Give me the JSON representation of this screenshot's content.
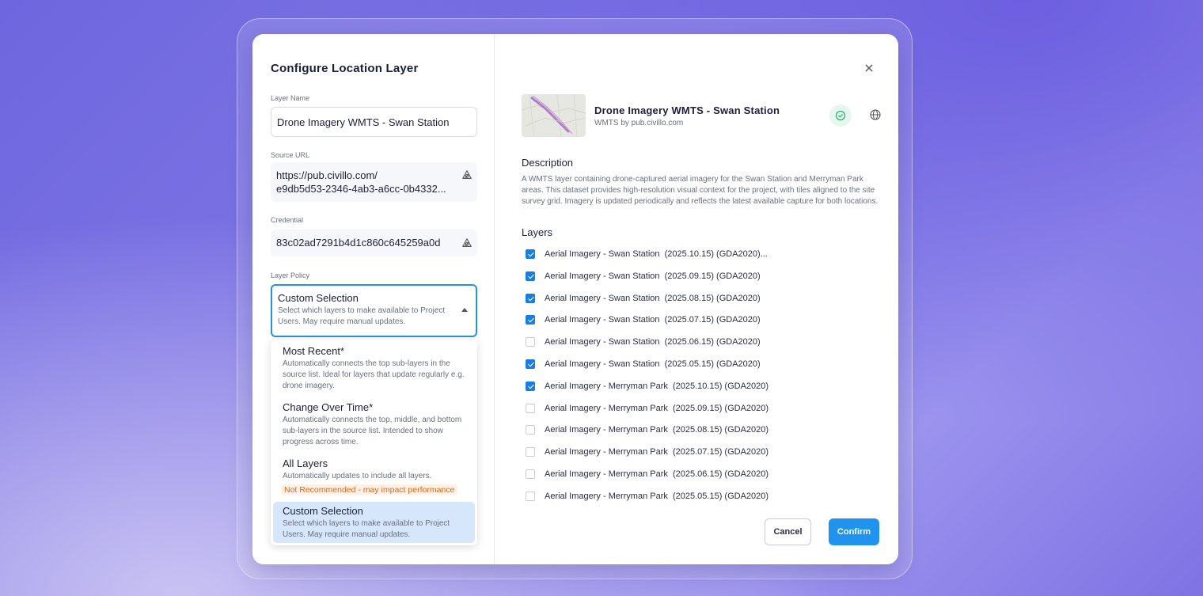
{
  "dialog": {
    "title": "Configure Location Layer",
    "layer_name_label": "Layer Name",
    "layer_name_value": "Drone Imagery WMTS - Swan Station",
    "source_url_label": "Source URL",
    "source_url_line1": "https://pub.civillo.com/",
    "source_url_line2": "e9db5d53-2346-4ab3-a6cc-0b4332...",
    "credential_label": "Credential",
    "credential_value": "83c02ad7291b4d1c860c645259a0d",
    "policy_label": "Layer Policy",
    "policy_selected": {
      "name": "Custom Selection",
      "desc": "Select which layers to make available to Project Users. May require manual updates."
    },
    "policy_options": [
      {
        "name": "Most Recent*",
        "desc": "Automatically connects the top sub-layers in the source list. Ideal for layers that update regularly e.g. drone imagery.",
        "warn": ""
      },
      {
        "name": "Change Over Time*",
        "desc": "Automatically connects the top, middle, and bottom sub-layers in the source list. Intended to show progress across time.",
        "warn": ""
      },
      {
        "name": "All Layers",
        "desc": "Automatically updates to include all layers.",
        "warn": "Not Recommended - may impact performance"
      },
      {
        "name": "Custom Selection",
        "desc": "Select which layers to make available to Project Users. May require manual updates.",
        "warn": ""
      }
    ]
  },
  "detail": {
    "name": "Drone Imagery WMTS - Swan Station",
    "source": "WMTS by pub.civillo.com",
    "description_heading": "Description",
    "description": "A WMTS layer containing drone-captured aerial imagery for the Swan Station and Merryman Park areas. This dataset provides high-resolution visual context for the project, with tiles aligned to the site survey grid. Imagery is updated periodically and reflects the latest available capture for both locations.",
    "layers_heading": "Layers",
    "layers": [
      {
        "label": "Aerial Imagery - Swan Station  (2025.10.15) (GDA2020)...",
        "checked": true
      },
      {
        "label": "Aerial Imagery - Swan Station  (2025.09.15) (GDA2020)",
        "checked": true
      },
      {
        "label": "Aerial Imagery - Swan Station  (2025.08.15) (GDA2020)",
        "checked": true
      },
      {
        "label": "Aerial Imagery - Swan Station  (2025.07.15) (GDA2020)",
        "checked": true
      },
      {
        "label": "Aerial Imagery - Swan Station  (2025.06.15) (GDA2020)",
        "checked": false
      },
      {
        "label": "Aerial Imagery - Swan Station  (2025.05.15) (GDA2020)",
        "checked": true
      },
      {
        "label": "Aerial Imagery - Merryman Park  (2025.10.15) (GDA2020)",
        "checked": true
      },
      {
        "label": "Aerial Imagery - Merryman Park  (2025.09.15) (GDA2020)",
        "checked": false
      },
      {
        "label": "Aerial Imagery - Merryman Park  (2025.08.15) (GDA2020)",
        "checked": false
      },
      {
        "label": "Aerial Imagery - Merryman Park  (2025.07.15) (GDA2020)",
        "checked": false
      },
      {
        "label": "Aerial Imagery - Merryman Park  (2025.06.15) (GDA2020)",
        "checked": false
      },
      {
        "label": "Aerial Imagery - Merryman Park  (2025.05.15) (GDA2020)",
        "checked": false
      }
    ],
    "cancel_label": "Cancel",
    "confirm_label": "Confirm"
  },
  "colors": {
    "accent": "#2093ee",
    "checkbox": "#1a7ee0",
    "warning": "#e5670e",
    "selected_option_bg": "#d7e7fb",
    "valid_badge": "#2fb37a"
  },
  "icons": {
    "close": "close-icon",
    "credential_visibility": "eye-off-icon",
    "valid": "check-circle-icon",
    "web": "globe-icon",
    "caret": "caret-up-icon"
  }
}
